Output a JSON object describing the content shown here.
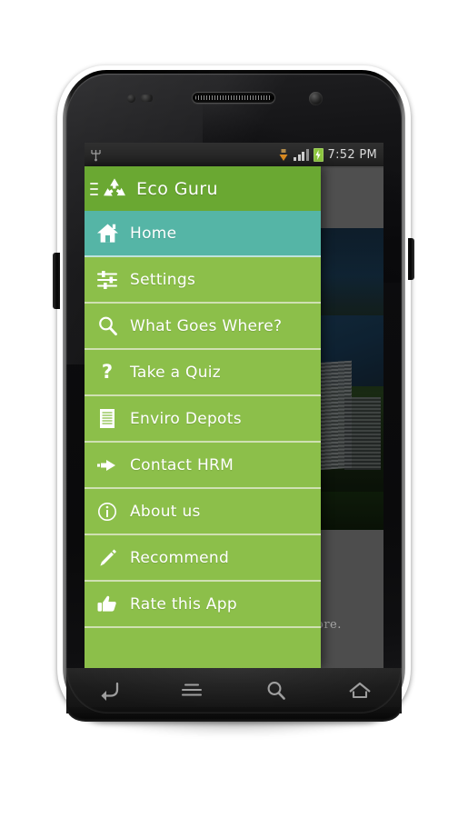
{
  "statusbar": {
    "time": "7:52 PM",
    "icons": [
      "usb-icon",
      "download-icon",
      "signal-icon",
      "battery-charging-icon"
    ]
  },
  "background_app": {
    "partial_text_right": "ore.",
    "partial_apostrophe": "'"
  },
  "drawer": {
    "menu_icon": "hamburger-icon",
    "logo_icon": "recycle-icon",
    "title": "Eco Guru",
    "items": [
      {
        "label": "Home",
        "icon": "home-icon",
        "active": true
      },
      {
        "label": "Settings",
        "icon": "sliders-icon",
        "active": false
      },
      {
        "label": "What Goes Where?",
        "icon": "search-icon",
        "active": false
      },
      {
        "label": "Take a Quiz",
        "icon": "question-icon",
        "active": false
      },
      {
        "label": "Enviro Depots",
        "icon": "list-icon",
        "active": false
      },
      {
        "label": "Contact HRM",
        "icon": "arrow-right-icon",
        "active": false
      },
      {
        "label": "About us",
        "icon": "info-icon",
        "active": false
      },
      {
        "label": "Recommend",
        "icon": "pencil-icon",
        "active": false
      },
      {
        "label": "Rate this App",
        "icon": "thumbs-up-icon",
        "active": false
      }
    ]
  },
  "navbar": {
    "buttons": [
      {
        "name": "back-button",
        "icon": "back-arrow-icon"
      },
      {
        "name": "menu-button",
        "icon": "menu-lines-icon"
      },
      {
        "name": "search-button",
        "icon": "search-icon"
      },
      {
        "name": "home-button",
        "icon": "home-outline-icon"
      }
    ]
  },
  "colors": {
    "header_green": "#6aa832",
    "item_green": "#8cbf4a",
    "active_teal": "#55b5a6",
    "divider": "#cfe0b2",
    "text_white": "#ffffff",
    "battery_green": "#8cc63e"
  }
}
